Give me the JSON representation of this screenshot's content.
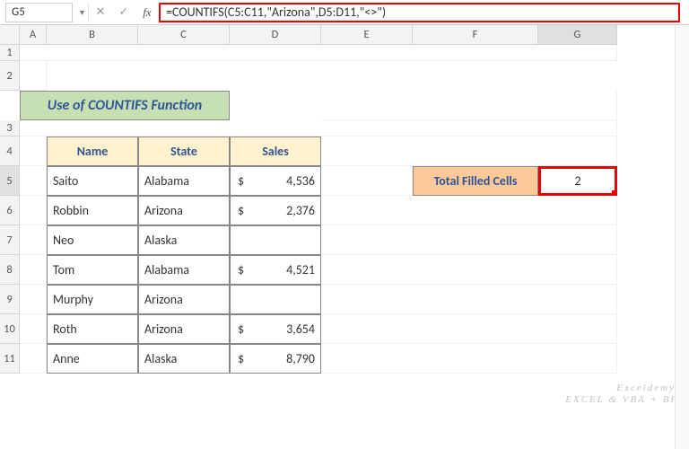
{
  "nameBox": "G5",
  "fbCancel": "✕",
  "fbConfirm": "✓",
  "fbFx": "fx",
  "formula": "=COUNTIFS(C5:C11,\"Arizona\",D5:D11,\"<>\")",
  "columns": [
    "A",
    "B",
    "C",
    "D",
    "E",
    "F",
    "G"
  ],
  "rows": [
    "1",
    "2",
    "3",
    "4",
    "5",
    "6",
    "7",
    "8",
    "9",
    "10",
    "11"
  ],
  "title": "Use of COUNTIFS Function",
  "headers": {
    "name": "Name",
    "state": "State",
    "sales": "Sales"
  },
  "filledLabel": "Total Filled Cells",
  "resultValue": "2",
  "data": [
    {
      "name": "Saito",
      "state": "Alabama",
      "sales": "4,536"
    },
    {
      "name": "Robbin",
      "state": "Arizona",
      "sales": "2,376"
    },
    {
      "name": "Neo",
      "state": "Alaska",
      "sales": ""
    },
    {
      "name": "Tom",
      "state": "Alabama",
      "sales": "4,521"
    },
    {
      "name": "Murphy",
      "state": "Arizona",
      "sales": ""
    },
    {
      "name": "Roth",
      "state": "Arizona",
      "sales": "3,654"
    },
    {
      "name": "Anne",
      "state": "Alaska",
      "sales": "8,790"
    }
  ],
  "watermark": {
    "l1": "Exceldemy",
    "l2": "EXCEL & VBA + BI"
  }
}
